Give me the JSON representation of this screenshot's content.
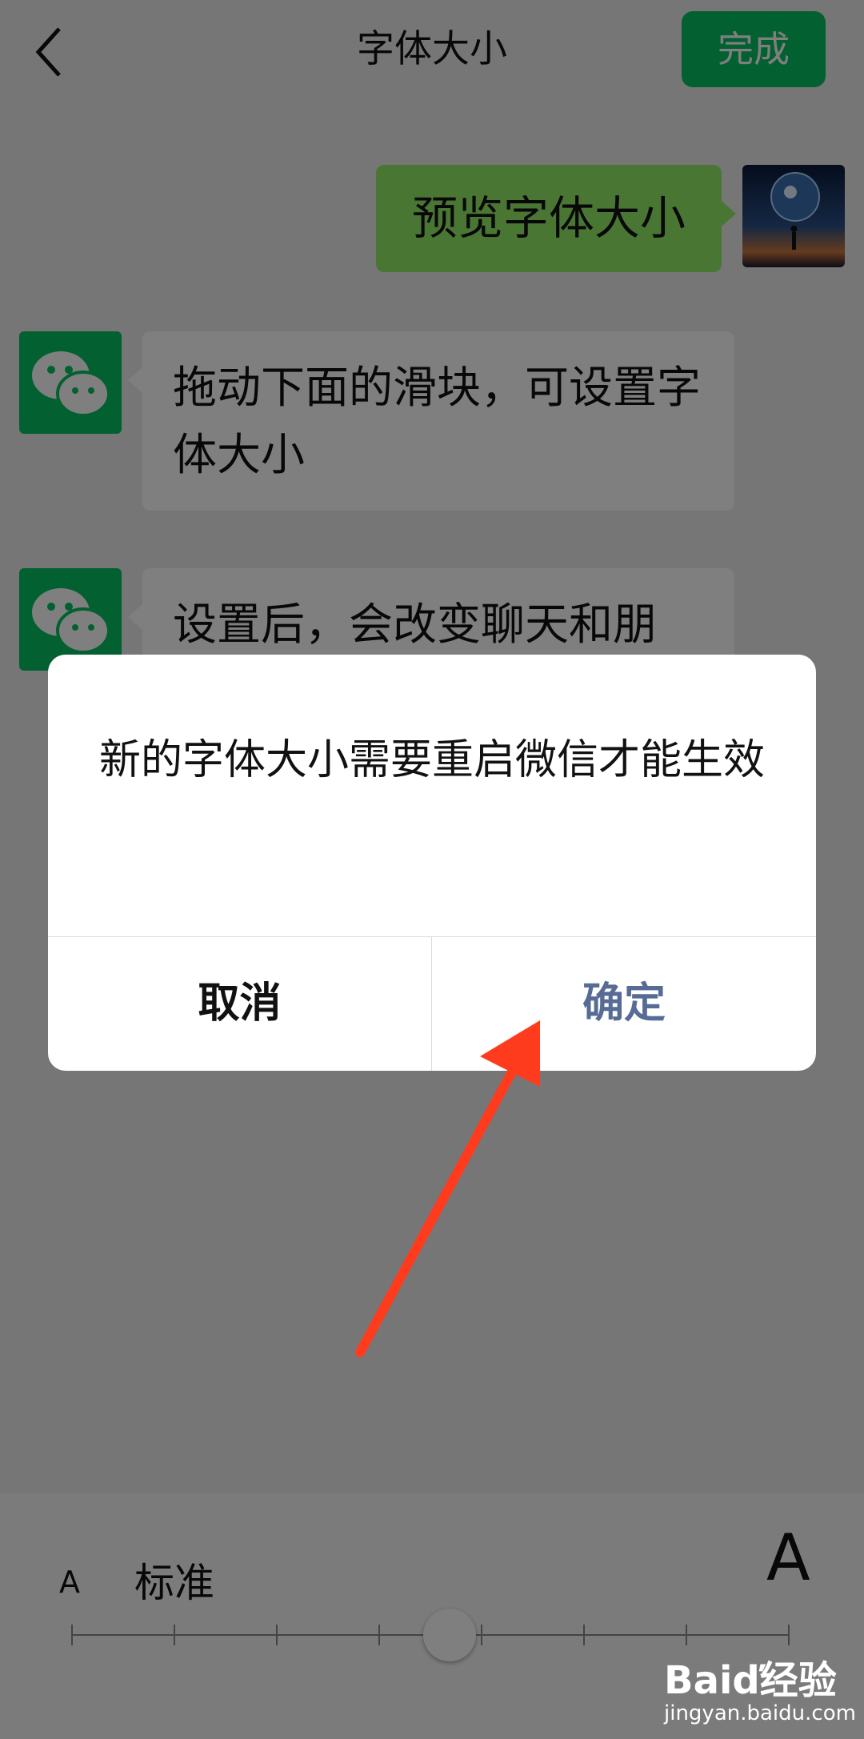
{
  "header": {
    "title": "字体大小",
    "done_label": "完成"
  },
  "chat": {
    "user_message": "预览字体大小",
    "msg1": "拖动下面的滑块，可设置字体大小",
    "msg2": "设置后，会改变聊天和朋"
  },
  "slider": {
    "small_label": "A",
    "current_label": "标准",
    "large_label": "A",
    "position_index": 4,
    "steps": 8
  },
  "dialog": {
    "message": "新的字体大小需要重启微信才能生效",
    "cancel_label": "取消",
    "confirm_label": "确定"
  },
  "watermark": {
    "logo": "Baiď经验",
    "url": "jingyan.baidu.com"
  },
  "colors": {
    "accent": "#07c160",
    "bubble_user": "#95ec69",
    "link_blue": "#576b95",
    "arrow": "#ff3b1e"
  }
}
